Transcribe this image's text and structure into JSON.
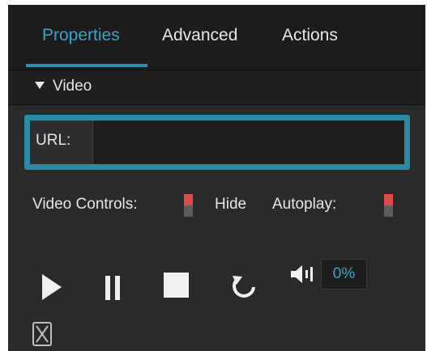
{
  "tabs": [
    {
      "label": "Properties",
      "active": true
    },
    {
      "label": "Advanced",
      "active": false
    },
    {
      "label": "Actions",
      "active": false
    }
  ],
  "section": {
    "title": "Video",
    "expanded": true
  },
  "url_field": {
    "label": "URL:",
    "value": "",
    "placeholder": ""
  },
  "controls_row": {
    "video_controls_label": "Video Controls:",
    "hide_label": "Hide",
    "autoplay_label": "Autoplay:"
  },
  "playback": {
    "play_icon": "play-icon",
    "pause_icon": "pause-icon",
    "stop_icon": "stop-icon",
    "replay_icon": "replay-icon",
    "volume_icon": "volume-icon",
    "volume_value": "0%",
    "fullscreen_icon": "fullscreen-icon"
  },
  "colors": {
    "accent": "#3fa2c9",
    "focus_border": "#2b8aa5",
    "toggle_on": "#e14a4a",
    "panel_bg": "#2a2a2a",
    "tabbar_bg": "#1c1c1c"
  }
}
